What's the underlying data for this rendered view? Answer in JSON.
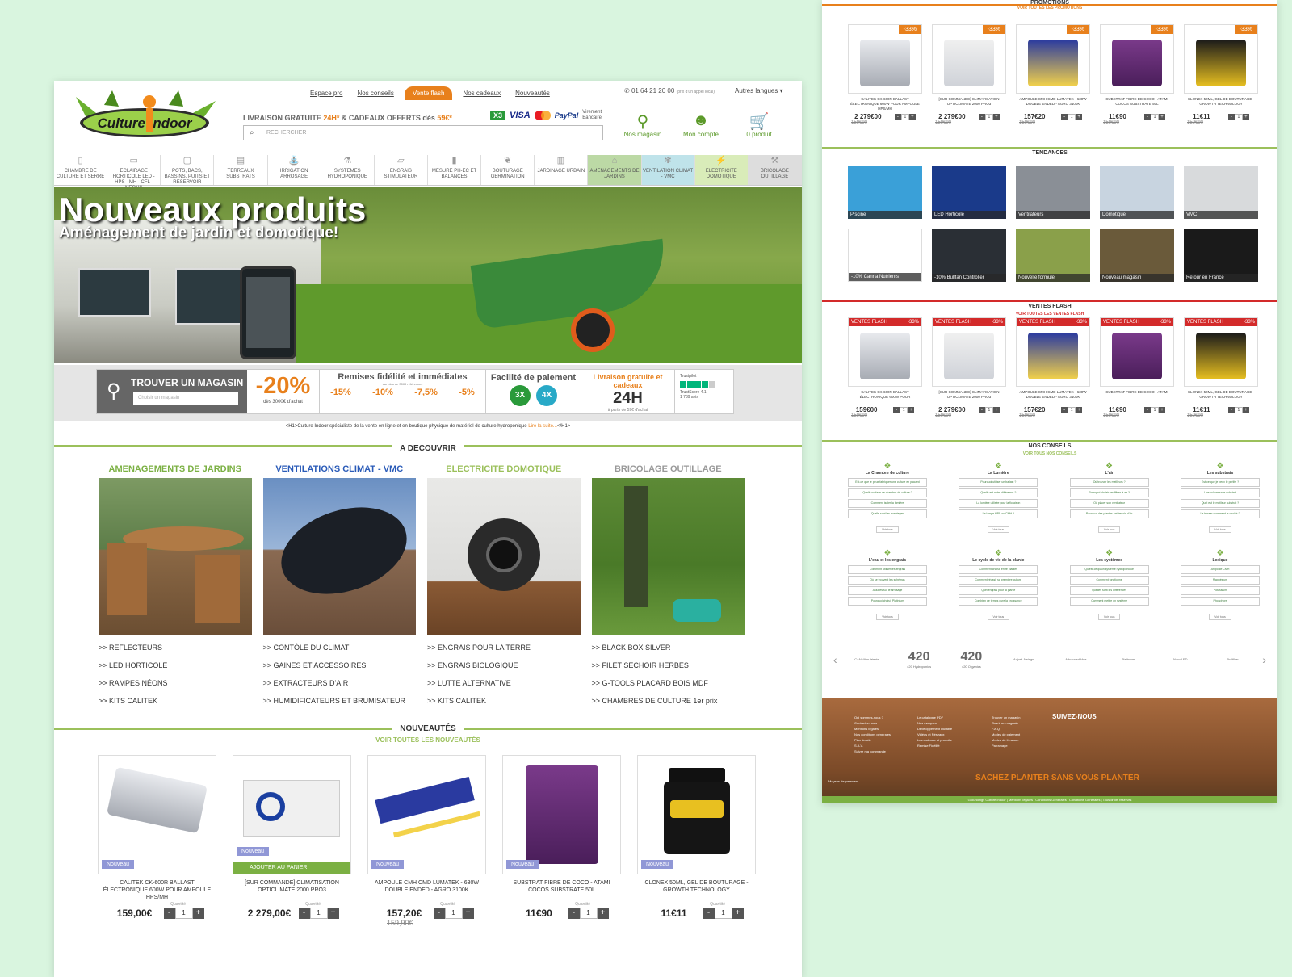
{
  "top_links": [
    "Espace pro",
    "Nos conseils",
    "Vente flash",
    "Nos cadeaux",
    "Nouveautés"
  ],
  "phone": "01 64 21 20 00",
  "phone_note": "(prix d'un appel local)",
  "languages": "Autres langues ▾",
  "logo_text": "Culture Indoor",
  "shipping": {
    "a": "LIVRAISON GRATUITE ",
    "b": "24H*",
    "c": " & CADEAUX OFFERTS dès ",
    "d": "59€*"
  },
  "payment": {
    "x3": "X3",
    "visa": "VISA",
    "paypal": "PayPal",
    "virement": "Virement Bancaire"
  },
  "search_placeholder": "RECHERCHER",
  "header_icons": [
    {
      "icon": "map-pin-icon",
      "label": "Nos magasin"
    },
    {
      "icon": "user-icon",
      "label": "Mon compte"
    },
    {
      "icon": "cart-icon",
      "label": "0 produit"
    }
  ],
  "nav": [
    "CHAMBRE DE CULTURE ET SERRE",
    "ECLAIRAGE HORTICOLE LED - HPS - MH - CFL - NEONS",
    "POTS, BACS, BASSINS, PUITS ET RESERVOIR",
    "TERREAUX SUBSTRATS",
    "IRRIGATION ARROSAGE",
    "SYSTEMES HYDROPONIQUE",
    "ENGRAIS STIMULATEUR",
    "MESURE PH-EC ET BALANCES",
    "BOUTURAGE GERMINATION",
    "JARDINAGE URBAIN",
    "AMENAGEMENTS DE JARDINS",
    "VENTILATION CLIMAT - VMC",
    "ELECTRICITE DOMOTIQUE",
    "BRICOLAGE OUTILLAGE"
  ],
  "hero": {
    "title": "Nouveaux produits",
    "subtitle": "Aménagement de jardin et domotique!"
  },
  "band": {
    "finder_title": "TROUVER UN MAGASIN",
    "finder_select": "Choisir un magasin",
    "pct": "-20%",
    "pct_sub": "dès 3000€ d'achat",
    "remise_title": "Remises fidélité et immédiates",
    "remise_sub": "sur plus de 3000 références",
    "remises": [
      "-15%",
      "-10%",
      "-7,5%",
      "-5%"
    ],
    "facil_title": "Facilité de paiement",
    "facil_3x": "3X",
    "facil_4x": "4X",
    "livr_title": "Livraison gratuite et cadeaux",
    "livr_big": "24H",
    "livr_sub": "à partir de 59€ d'achat",
    "trust": "Trustpilot",
    "trust_score": "TrustScore 4.1",
    "trust_reviews": "1 739 avis"
  },
  "h1_text": "<H1>Culture Indoor spécialiste de la vente en ligne et en boutique physique de matériel de culture hydroponique ",
  "h1_link": "Lire la suite...",
  "h1_end": "</H1>",
  "discover_title": "A DECOUVRIR",
  "categories": [
    {
      "title": "AMENAGEMENTS DE JARDINS",
      "color": "#7bb043",
      "links": [
        ">> RÉFLECTEURS",
        ">> LED HORTICOLE",
        ">> RAMPES NÉONS",
        ">> KITS CALITEK"
      ]
    },
    {
      "title": "VENTILATIONS CLIMAT - VMC",
      "color": "#2a5bb8",
      "links": [
        ">> CONTÔLE DU CLIMAT",
        ">> GAINES ET ACCESSOIRES",
        ">> EXTRACTEURS D'AIR",
        ">> HUMIDIFICATEURS ET BRUMISATEUR"
      ]
    },
    {
      "title": "ELECTRICITE DOMOTIQUE",
      "color": "#9bc05b",
      "links": [
        ">> ENGRAIS POUR LA TERRE",
        ">> ENGRAIS BIOLOGIQUE",
        ">> LUTTE ALTERNATIVE",
        ">> KITS CALITEK"
      ]
    },
    {
      "title": "BRICOLAGE OUTILLAGE",
      "color": "#999999",
      "links": [
        ">> BLACK BOX SILVER",
        ">> FILET SECHOIR HERBES",
        ">> G-TOOLS PLACARD BOIS MDF",
        ">> CHAMBRES DE CULTURE 1er prix"
      ]
    }
  ],
  "nouveautes": {
    "title": "NOUVEAUTÉS",
    "link": "VOIR TOUTES LES NOUVEAUTÉS",
    "badge": "Nouveau",
    "qty_label": "Quantité",
    "add": "AJOUTER AU PANIER"
  },
  "products": [
    {
      "name": "CALITEK CK-600R BALLAST ÉLECTRONIQUE 600W POUR AMPOULE HPS/MH",
      "price": "159,00€",
      "old": ""
    },
    {
      "name": "[SUR COMMANDE] CLIMATISATION OPTICLIMATE 2000 PRO3",
      "price": "2 279,00€",
      "old": ""
    },
    {
      "name": "AMPOULE CMH CMD LUMATEK - 630W DOUBLE ENDED - AGRO 3100K",
      "price": "157,20€",
      "old": "159,90€"
    },
    {
      "name": "SUBSTRAT FIBRE DE COCO - ATAMI COCOS SUBSTRATE 50L",
      "price": "11€90",
      "old": ""
    },
    {
      "name": "CLONEX 50ML, GEL DE BOUTURAGE - GROWTH TECHNOLOGY",
      "price": "11€11",
      "old": ""
    }
  ],
  "p2": {
    "promo_title": "PROMOTIONS",
    "promo_link": "VOIR TOUTES LES PROMOTIONS",
    "promo_tag": "-33%",
    "badge": "Nouveau",
    "add": "AJOUTER AU PANIER",
    "promos": [
      {
        "name": "CALITEK CK-600R BALLAST ÉLECTRONIQUE 600W POUR AMPOULE HPS/MH",
        "price": "2 279€00",
        "old": "159€90"
      },
      {
        "name": "[SUR COMMANDE] CLIMATISATION OPTICLIMATE 2000 PRO3",
        "price": "2 279€00",
        "old": "159€90"
      },
      {
        "name": "AMPOULE CMH CMD LUMATEK - 630W DOUBLE ENDED - AGRO 3100K",
        "price": "157€20",
        "old": "159€90"
      },
      {
        "name": "SUBSTRAT FIBRE DE COCO - ATAMI COCOS SUBSTRATE 50L",
        "price": "11€90",
        "old": "159€90"
      },
      {
        "name": "CLONEX 50ML, GEL DE BOUTURAGE - GROWTH TECHNOLOGY",
        "price": "11€11",
        "old": "159€90"
      }
    ],
    "trend_title": "TENDANCES",
    "trends": [
      "Piscine",
      "LED Horticole",
      "Ventilateurs",
      "Domotique",
      "VMC",
      "-10% Canna Nutrients",
      "-10% Bullfan Controller",
      "Nouvelle formule",
      "Nouveau magasin",
      "Retour en France"
    ],
    "flash_title": "VENTES FLASH",
    "flash_link": "VOIR TOUTES LES VENTES FLASH",
    "flash_tag": "VENTES FLASH",
    "flash_pct": "-33%",
    "flash": [
      {
        "name": "CALITEK CK-600R BALLAST ÉLECTRONIQUE 600W POUR",
        "price": "159€00",
        "old": "159€90"
      },
      {
        "name": "[SUR COMMANDE] CLIMATISATION OPTICLIMATE 2000 PRO3",
        "price": "2 279€00",
        "old": "159€90"
      },
      {
        "name": "AMPOULE CMH CMD LUMATEK - 630W DOUBLE ENDED - AGRO 3100K",
        "price": "157€20",
        "old": "159€90"
      },
      {
        "name": "SUBSTRAT FIBRE DE COCO - ATAMI",
        "price": "11€90",
        "old": "159€90"
      },
      {
        "name": "CLONEX 50ML, GEL DE BOUTURAGE - GROWTH TECHNOLOGY",
        "price": "11€11",
        "old": "159€90"
      }
    ],
    "conseils_title": "NOS CONSEILS",
    "conseils_link": "VOIR TOUS NOS CONSEILS",
    "more": "Voir tous",
    "conseils": [
      {
        "t": "La Chambre de culture",
        "q": [
          "Est-ce que je peux fabriquer une culture en placard",
          "Quelle surface de chambre de culture ?",
          "Comment isoler la lumière",
          "Quelle sont les avantages"
        ]
      },
      {
        "t": "La Lumière",
        "q": [
          "Pourquoi utiliser un ballast ?",
          "Quelle est notre différence ?",
          "La lumière utilisée pour la floraison",
          "La lampe HPS ou CMH ?"
        ]
      },
      {
        "t": "L'air",
        "q": [
          "Où trouver les meilleurs ?",
          "Pourquoi choisir les filtres à air ?",
          "Où placer son ventilateur",
          "Pourquoi des plantes ont besoin d'air"
        ]
      },
      {
        "t": "Les substrats",
        "q": [
          "Est-ce que je peux le perlite ?",
          "Une culture sans substrat",
          "Quel est le meilleur substrat ?",
          "Le terreau comment le choisir ?"
        ]
      },
      {
        "t": "L'eau et les engrais",
        "q": [
          "Comment utiliser les engrais",
          "Où se trouvent les schémas",
          "Astuces sur le arrosage",
          "Pourquoi choisir Platinium"
        ]
      },
      {
        "t": "Le cycle de vie de la plante",
        "q": [
          "Comment choisir entre plantes",
          "Comment réussir sa première culture",
          "Quel engrais pour la plante",
          "Combien de temps dure la croissance"
        ]
      },
      {
        "t": "Les systèmes",
        "q": [
          "Qu'est-ce qu'un système hydroponique",
          "Comment fonctionne",
          "Quelles sont les différences",
          "Comment mettre un système"
        ]
      },
      {
        "t": "Lexique",
        "q": [
          "Ampoule CMH",
          "Magnésium",
          "Potassium",
          "Phosphore"
        ]
      }
    ],
    "brands": [
      {
        "n": "",
        "s": "CANNA nutrients"
      },
      {
        "n": "420",
        "s": "420 Hydroponics"
      },
      {
        "n": "420",
        "s": "420 Organics"
      },
      {
        "n": "",
        "s": "Adjust-Awings"
      },
      {
        "n": "",
        "s": "Advanced Hue"
      },
      {
        "n": "",
        "s": "Platinium"
      },
      {
        "n": "",
        "s": "NanoLED"
      },
      {
        "n": "",
        "s": "Bullfilter"
      }
    ],
    "follow": "SUIVEZ-NOUS",
    "slogan": "SACHEZ PLANTER SANS VOUS PLANTER",
    "payments_label": "Moyens de paiement",
    "footer_bottom": "Groundings Culture Indoor | Mentions légales | Conditions Générales | Conditions Générales | Tous droits réservés"
  }
}
